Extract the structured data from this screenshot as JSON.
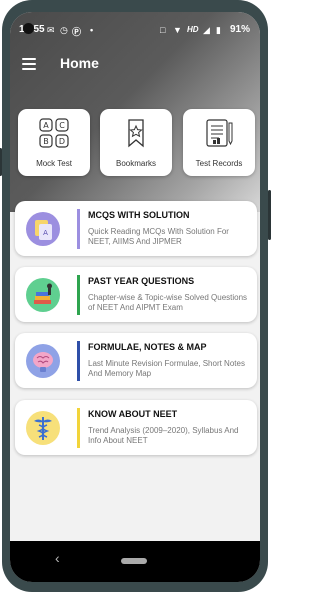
{
  "status_bar": {
    "time": "10:55",
    "icons": [
      "message-icon",
      "clock-icon",
      "p-icon",
      "dot-icon",
      "vibrate-icon",
      "wifi-icon",
      "hd-icon",
      "signal-icon",
      "battery-icon"
    ],
    "hd": "HD",
    "battery": "91%"
  },
  "header": {
    "title": "Home",
    "color": "#ffffff"
  },
  "tiles": [
    {
      "label": "Mock Test",
      "icon": "abc-grid-icon"
    },
    {
      "label": "Bookmarks",
      "icon": "bookmark-star-icon"
    },
    {
      "label": "Test Records",
      "icon": "records-document-icon"
    }
  ],
  "cards": [
    {
      "title": "MCQS WITH SOLUTION",
      "description": "Quick Reading MCQs With Solution For NEET, AIIMS And JIPMER",
      "accent": "#9c8fe0",
      "icon": "mcq-icon"
    },
    {
      "title": "PAST YEAR QUESTIONS",
      "description": "Chapter-wise & Topic-wise Solved Questions of NEET And AIPMT Exam",
      "accent": "#2ea44f",
      "icon": "books-icon"
    },
    {
      "title": "FORMULAE, NOTES & MAP",
      "description": "Last Minute Revision Formulae, Short Notes And Memory Map",
      "accent": "#2f4fa8",
      "icon": "brain-icon"
    },
    {
      "title": "KNOW ABOUT NEET",
      "description": "Trend Analysis (2009–2020), Syllabus And Info About NEET",
      "accent": "#f2d43a",
      "icon": "caduceus-icon"
    }
  ],
  "nav": {
    "back": "‹"
  }
}
